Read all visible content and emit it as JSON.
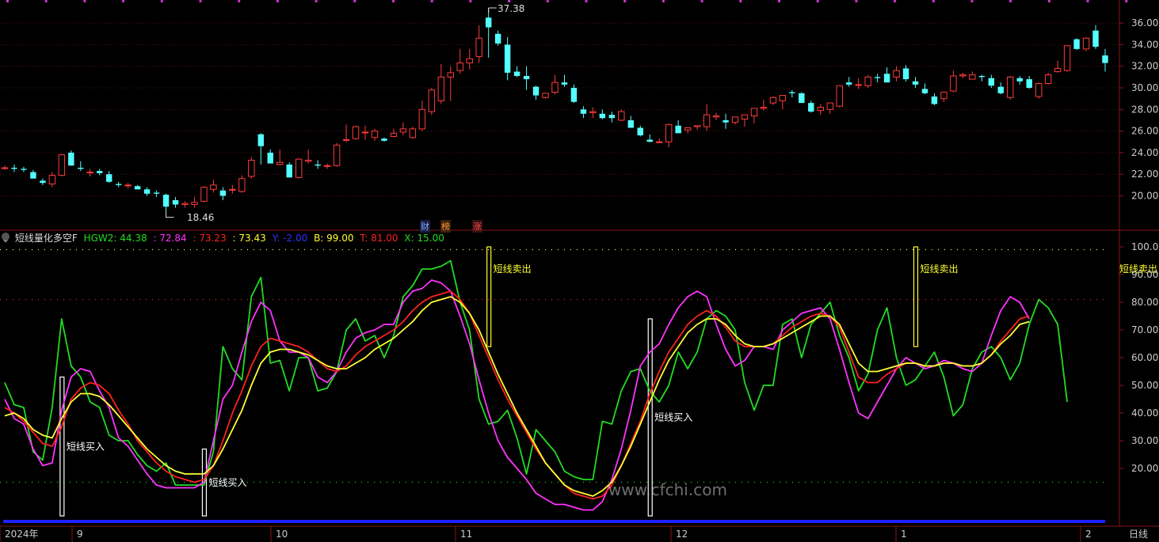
{
  "colors": {
    "up": "#ff3b3b",
    "down": "#54ffff",
    "hgw2": "#22dd22",
    "k": "#ff33ff",
    "d": "#ff2020",
    "j": "#ffff33",
    "y": "#2020ff",
    "b": "#ffff33",
    "t": "#ff2020",
    "x": "#22dd22"
  },
  "price_axis": {
    "ticks": [
      "36.00",
      "34.00",
      "32.00",
      "30.00",
      "28.00",
      "26.00",
      "24.00",
      "22.00",
      "20.00"
    ]
  },
  "price_labels": {
    "high": "37.38",
    "low": "18.46"
  },
  "badges": {
    "cai": "财",
    "bang": "榜",
    "zhang": "涨"
  },
  "indicator_legend": {
    "name": "短线量化多空F",
    "hgw2": "HGW2: 44.38",
    "k": ": 72.84",
    "d": ": 73.23",
    "j": ": 73.43",
    "y": "Y: -2.00",
    "b": "B: 99.00",
    "t": "T: 81.00",
    "x": "X: 15.00"
  },
  "indicator_axis": {
    "ticks": [
      "100.00",
      "90.00",
      "80.00",
      "70.00",
      "60.00",
      "50.00",
      "40.00",
      "30.00",
      "20.00"
    ]
  },
  "signals": {
    "buy": "短线买入",
    "sell": "短线卖出"
  },
  "time_axis": {
    "labels": [
      "2024年",
      "9",
      "10",
      "11",
      "12",
      "1",
      "2"
    ],
    "period": "日线"
  },
  "watermark": "www.cfchi.com",
  "chart_data": [
    {
      "type": "candlestick",
      "ylim": [
        18.5,
        37.4
      ],
      "yticks": [
        20,
        22,
        24,
        26,
        28,
        30,
        32,
        34,
        36
      ],
      "x_labels": [
        "9",
        "10",
        "11",
        "12",
        "1",
        "2"
      ],
      "candles_ohlc": [
        [
          22.6,
          22.8,
          22.4,
          22.6
        ],
        [
          22.6,
          22.9,
          22.2,
          22.5
        ],
        [
          22.5,
          22.7,
          22.2,
          22.4
        ],
        [
          22.2,
          22.4,
          21.6,
          21.6
        ],
        [
          21.4,
          21.6,
          21.0,
          21.2
        ],
        [
          21.1,
          22.2,
          20.8,
          21.9
        ],
        [
          21.9,
          23.9,
          21.8,
          23.8
        ],
        [
          24.0,
          24.2,
          22.8,
          22.8
        ],
        [
          22.6,
          23.2,
          22.3,
          22.5
        ],
        [
          22.2,
          22.5,
          21.8,
          22.2
        ],
        [
          22.3,
          22.5,
          21.9,
          22.1
        ],
        [
          22.0,
          22.3,
          21.2,
          21.3
        ],
        [
          21.1,
          21.3,
          20.8,
          21.0
        ],
        [
          21.0,
          21.2,
          20.7,
          21.0
        ],
        [
          20.9,
          21.0,
          20.6,
          20.6
        ],
        [
          20.6,
          20.8,
          20.0,
          20.2
        ],
        [
          20.3,
          20.5,
          19.9,
          20.2
        ],
        [
          20.1,
          20.2,
          18.6,
          19.0
        ],
        [
          19.6,
          19.9,
          18.9,
          19.2
        ],
        [
          19.2,
          19.5,
          18.9,
          19.3
        ],
        [
          19.2,
          19.9,
          18.9,
          19.4
        ],
        [
          19.5,
          20.9,
          19.4,
          20.8
        ],
        [
          20.6,
          21.5,
          20.3,
          21.0
        ],
        [
          20.5,
          20.8,
          19.6,
          20.0
        ],
        [
          20.6,
          21.0,
          20.2,
          20.6
        ],
        [
          20.4,
          21.9,
          20.3,
          21.6
        ],
        [
          21.8,
          23.6,
          21.6,
          23.3
        ],
        [
          25.7,
          25.8,
          22.9,
          24.6
        ],
        [
          24.0,
          24.3,
          23.0,
          23.0
        ],
        [
          22.9,
          24.3,
          22.8,
          23.1
        ],
        [
          22.9,
          23.1,
          21.7,
          21.7
        ],
        [
          21.7,
          23.5,
          21.6,
          23.4
        ],
        [
          23.2,
          24.3,
          23.0,
          23.3
        ],
        [
          22.9,
          23.3,
          22.5,
          22.8
        ],
        [
          22.8,
          23.0,
          22.5,
          22.8
        ],
        [
          22.8,
          24.9,
          22.7,
          24.7
        ],
        [
          25.2,
          26.6,
          25.0,
          25.2
        ],
        [
          25.3,
          26.5,
          25.2,
          26.4
        ],
        [
          25.9,
          26.5,
          25.2,
          25.9
        ],
        [
          25.4,
          26.2,
          25.1,
          26.0
        ],
        [
          25.3,
          25.4,
          25.0,
          25.1
        ],
        [
          25.5,
          26.2,
          25.4,
          25.8
        ],
        [
          25.9,
          26.8,
          25.6,
          26.2
        ],
        [
          25.4,
          26.4,
          25.3,
          26.2
        ],
        [
          26.2,
          28.8,
          26.0,
          28.0
        ],
        [
          27.8,
          30.0,
          27.5,
          29.8
        ],
        [
          28.8,
          32.2,
          28.5,
          31.0
        ],
        [
          31.0,
          32.0,
          28.8,
          31.4
        ],
        [
          31.6,
          33.6,
          31.3,
          32.3
        ],
        [
          32.3,
          33.6,
          31.7,
          32.7
        ],
        [
          32.9,
          35.8,
          32.3,
          34.6
        ],
        [
          36.5,
          37.4,
          32.8,
          35.6
        ],
        [
          35.0,
          35.3,
          33.9,
          34.1
        ],
        [
          34.0,
          34.7,
          30.7,
          31.4
        ],
        [
          31.5,
          32.0,
          31.0,
          31.1
        ],
        [
          31.1,
          32.0,
          29.8,
          30.8
        ],
        [
          30.1,
          30.2,
          28.9,
          29.3
        ],
        [
          29.1,
          29.5,
          29.0,
          29.5
        ],
        [
          29.6,
          31.2,
          29.4,
          30.5
        ],
        [
          30.5,
          31.2,
          30.1,
          30.3
        ],
        [
          30.0,
          30.3,
          28.6,
          28.7
        ],
        [
          28.0,
          28.3,
          27.2,
          27.6
        ],
        [
          27.7,
          28.2,
          27.2,
          27.8
        ],
        [
          27.6,
          28.0,
          27.1,
          27.2
        ],
        [
          27.5,
          27.8,
          26.8,
          27.2
        ],
        [
          27.0,
          28.0,
          26.9,
          27.8
        ],
        [
          27.0,
          27.4,
          26.3,
          26.3
        ],
        [
          26.3,
          26.5,
          25.5,
          25.6
        ],
        [
          25.2,
          25.7,
          25.0,
          25.0
        ],
        [
          25.0,
          25.3,
          24.9,
          25.0
        ],
        [
          25.0,
          26.7,
          24.5,
          26.6
        ],
        [
          26.5,
          27.0,
          25.8,
          25.8
        ],
        [
          26.1,
          26.3,
          25.8,
          26.3
        ],
        [
          26.4,
          26.5,
          26.1,
          26.5
        ],
        [
          26.4,
          28.5,
          26.0,
          27.5
        ],
        [
          27.3,
          27.7,
          27.0,
          27.4
        ],
        [
          27.0,
          27.6,
          26.2,
          26.8
        ],
        [
          26.8,
          27.2,
          26.6,
          27.3
        ],
        [
          27.1,
          27.2,
          26.4,
          27.5
        ],
        [
          27.4,
          27.9,
          26.7,
          28.1
        ],
        [
          28.1,
          28.9,
          27.9,
          28.2
        ],
        [
          28.6,
          29.2,
          28.4,
          29.1
        ],
        [
          28.8,
          29.2,
          28.0,
          29.3
        ],
        [
          29.6,
          29.8,
          29.1,
          29.5
        ],
        [
          29.5,
          29.6,
          28.6,
          28.6
        ],
        [
          28.6,
          28.8,
          27.7,
          27.8
        ],
        [
          27.9,
          28.5,
          27.5,
          28.2
        ],
        [
          28.0,
          28.6,
          27.6,
          28.6
        ],
        [
          28.3,
          30.2,
          28.2,
          30.2
        ],
        [
          30.5,
          31.0,
          30.1,
          30.3
        ],
        [
          30.3,
          30.9,
          29.9,
          30.3
        ],
        [
          30.2,
          31.2,
          30.0,
          31.0
        ],
        [
          31.0,
          31.3,
          30.5,
          30.9
        ],
        [
          31.3,
          31.9,
          30.6,
          30.5
        ],
        [
          31.0,
          32.0,
          30.6,
          31.6
        ],
        [
          31.8,
          32.1,
          30.6,
          30.8
        ],
        [
          30.6,
          31.0,
          30.0,
          30.3
        ],
        [
          29.9,
          30.4,
          29.4,
          29.5
        ],
        [
          29.2,
          29.5,
          28.4,
          28.5
        ],
        [
          29.0,
          29.6,
          28.7,
          29.6
        ],
        [
          29.7,
          31.6,
          29.6,
          31.1
        ],
        [
          31.1,
          31.4,
          30.9,
          31.2
        ],
        [
          30.8,
          31.5,
          30.8,
          31.2
        ],
        [
          31.1,
          31.2,
          30.6,
          31.0
        ],
        [
          30.9,
          31.2,
          30.0,
          30.2
        ],
        [
          30.1,
          30.5,
          29.4,
          29.5
        ],
        [
          29.1,
          31.1,
          28.9,
          31.0
        ],
        [
          30.9,
          31.1,
          30.3,
          30.6
        ],
        [
          30.8,
          31.1,
          29.9,
          30.0
        ],
        [
          29.2,
          30.5,
          29.0,
          30.4
        ],
        [
          30.4,
          31.4,
          30.3,
          31.2
        ],
        [
          31.5,
          32.5,
          31.4,
          31.8
        ],
        [
          31.6,
          33.9,
          31.5,
          33.9
        ],
        [
          34.5,
          34.6,
          33.5,
          33.6
        ],
        [
          33.6,
          34.7,
          33.4,
          34.6
        ],
        [
          35.3,
          35.8,
          33.6,
          33.8
        ],
        [
          33.0,
          33.6,
          31.5,
          32.3
        ]
      ]
    },
    {
      "type": "line",
      "ylim": [
        4,
        100
      ],
      "yticks": [
        20,
        30,
        40,
        50,
        60,
        70,
        80,
        90,
        100
      ],
      "reference_lines": [
        {
          "name": "B",
          "value": 99.0
        },
        {
          "name": "T",
          "value": 81.0
        },
        {
          "name": "X",
          "value": 15.0
        },
        {
          "name": "Y",
          "value": -2.0
        }
      ],
      "series": [
        {
          "name": "HGW2",
          "values": [
            51,
            43,
            42,
            26,
            23,
            42,
            74,
            57,
            53,
            44,
            42,
            32,
            30,
            30,
            25,
            21,
            19,
            22,
            14,
            14,
            14,
            14,
            26,
            64,
            56,
            52,
            82,
            89,
            58,
            59,
            48,
            60,
            60,
            48,
            49,
            55,
            70,
            74,
            66,
            68,
            60,
            68,
            82,
            86,
            92,
            92,
            93,
            95,
            80,
            70,
            45,
            36,
            37,
            41,
            31,
            18,
            34,
            30,
            26,
            19,
            17,
            16,
            16,
            37,
            36,
            48,
            55,
            56,
            48,
            44,
            50,
            62,
            56,
            62,
            74,
            77,
            75,
            70,
            51,
            41,
            50,
            50,
            72,
            74,
            60,
            72,
            76,
            80,
            68,
            60,
            48,
            54,
            70,
            78,
            60,
            50,
            52,
            57,
            62,
            53,
            39,
            43,
            56,
            62,
            64,
            60,
            52,
            58,
            72,
            81,
            78,
            72,
            44
          ]
        },
        {
          "name": "K",
          "values": [
            45,
            38,
            36,
            27,
            21,
            22,
            41,
            53,
            56,
            55,
            48,
            42,
            31,
            28,
            23,
            18,
            14,
            13,
            13,
            13,
            13,
            15,
            30,
            45,
            50,
            62,
            73,
            80,
            77,
            66,
            62,
            62,
            60,
            53,
            51,
            55,
            62,
            67,
            69,
            70,
            72,
            72,
            80,
            84,
            85,
            88,
            87,
            84,
            75,
            65,
            52,
            40,
            30,
            24,
            20,
            16,
            11,
            9,
            7,
            7,
            6,
            5,
            5,
            8,
            16,
            27,
            41,
            57,
            62,
            65,
            72,
            78,
            82,
            84,
            82,
            72,
            63,
            57,
            59,
            64,
            64,
            63,
            70,
            73,
            76,
            77,
            78,
            74,
            63,
            51,
            40,
            38,
            44,
            50,
            56,
            60,
            58,
            56,
            57,
            59,
            58,
            56,
            55,
            58,
            68,
            77,
            82,
            80,
            74
          ]
        },
        {
          "name": "D",
          "values": [
            42,
            40,
            37,
            33,
            29,
            28,
            35,
            45,
            49,
            51,
            50,
            47,
            41,
            36,
            30,
            26,
            22,
            19,
            17,
            16,
            15,
            16,
            21,
            30,
            40,
            48,
            57,
            64,
            67,
            66,
            65,
            64,
            62,
            59,
            56,
            55,
            57,
            61,
            64,
            66,
            68,
            70,
            73,
            77,
            80,
            82,
            83,
            84,
            81,
            76,
            68,
            60,
            52,
            45,
            39,
            33,
            27,
            22,
            18,
            14,
            11,
            10,
            9,
            10,
            14,
            21,
            29,
            37,
            47,
            55,
            62,
            67,
            72,
            75,
            77,
            75,
            71,
            66,
            64,
            64,
            64,
            65,
            68,
            71,
            73,
            75,
            76,
            75,
            71,
            62,
            53,
            51,
            51,
            54,
            56,
            58,
            58,
            57,
            57,
            58,
            58,
            57,
            57,
            58,
            61,
            66,
            70,
            74,
            75
          ]
        },
        {
          "name": "J",
          "values": [
            39,
            40,
            38,
            34,
            32,
            31,
            38,
            44,
            47,
            47,
            46,
            43,
            39,
            35,
            31,
            27,
            24,
            21,
            19,
            18,
            18,
            18,
            21,
            27,
            34,
            41,
            50,
            58,
            62,
            63,
            63,
            62,
            61,
            59,
            57,
            56,
            56,
            58,
            60,
            63,
            65,
            67,
            70,
            73,
            77,
            80,
            81,
            82,
            80,
            76,
            70,
            62,
            54,
            47,
            40,
            34,
            28,
            22,
            18,
            14,
            12,
            11,
            10,
            12,
            15,
            21,
            28,
            36,
            44,
            52,
            59,
            64,
            69,
            72,
            74,
            74,
            72,
            68,
            65,
            64,
            64,
            65,
            67,
            69,
            71,
            73,
            75,
            75,
            72,
            65,
            58,
            55,
            55,
            56,
            57,
            58,
            58,
            57,
            57,
            58,
            58,
            57,
            57,
            58,
            61,
            65,
            68,
            72,
            73
          ]
        }
      ],
      "markers": [
        {
          "label": "短线买入",
          "index": 6
        },
        {
          "label": "短线买入",
          "index": 21
        },
        {
          "label": "短线买入",
          "index": 68
        },
        {
          "label": "短线卖出",
          "index": 51
        },
        {
          "label": "短线卖出",
          "index": 96
        },
        {
          "label": "短线卖出",
          "index": 117
        }
      ]
    }
  ]
}
